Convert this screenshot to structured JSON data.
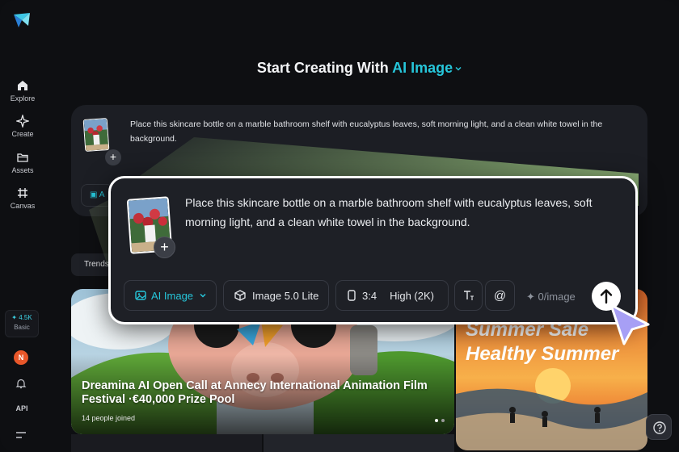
{
  "colors": {
    "accent": "#26c6da",
    "background": "#0e0f12",
    "panel": "#1e2026"
  },
  "sidebar": {
    "items": [
      {
        "label": "Explore",
        "icon": "home-icon"
      },
      {
        "label": "Create",
        "icon": "sparkle-icon"
      },
      {
        "label": "Assets",
        "icon": "folder-icon"
      },
      {
        "label": "Canvas",
        "icon": "grid-icon"
      }
    ],
    "credits": {
      "value": "4.5K",
      "plan": "Basic"
    },
    "avatar_initial": "N",
    "api_label": "API"
  },
  "header": {
    "prefix": "Start Creating With",
    "mode": "AI Image"
  },
  "background_prompt": {
    "text": "Place this skincare bottle on a marble bathroom shelf with eucalyptus leaves, soft morning light, and a clean white towel in the background.",
    "chip_label": "A"
  },
  "trends_label": "Trends",
  "prompt_card": {
    "text": "Place this skincare bottle on a marble bathroom shelf with eucalyptus leaves, soft morning light, and a clean white towel in the background.",
    "mode_label": "AI Image",
    "model_label": "Image 5.0 Lite",
    "ratio_label": "3:4",
    "quality_label": "High (2K)",
    "cost_label": "0/image"
  },
  "gallery": {
    "main_card": {
      "title": "Dreamina AI Open Call at Annecy International Animation Film Festival ·€40,000 Prize Pool",
      "subtitle": "14 people joined"
    },
    "right_card": {
      "line1": "Summer Sale",
      "line2": "Healthy Summer"
    }
  }
}
